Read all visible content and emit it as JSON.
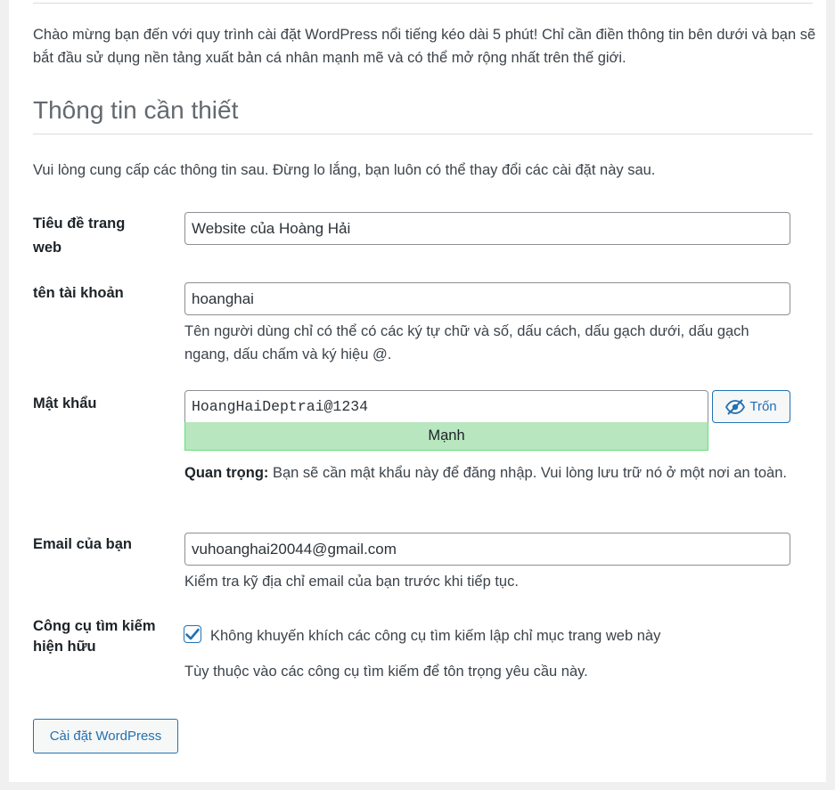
{
  "intro": "Chào mừng bạn đến với quy trình cài đặt WordPress nổi tiếng kéo dài 5 phút! Chỉ cần điền thông tin bên dưới và bạn sẽ bắt đầu sử dụng nền tảng xuất bản cá nhân mạnh mẽ và có thể mở rộng nhất trên thế giới.",
  "heading": "Thông tin cần thiết",
  "subintro": "Vui lòng cung cấp các thông tin sau. Đừng lo lắng, bạn luôn có thể thay đổi các cài đặt này sau.",
  "fields": {
    "site_title": {
      "label": "Tiêu đề trang web",
      "value": "Website của Hoàng Hải"
    },
    "username": {
      "label": "tên tài khoản",
      "value": "hoanghai",
      "description": "Tên người dùng chỉ có thể có các ký tự chữ và số, dấu cách, dấu gạch dưới, dấu gạch ngang, dấu chấm và ký hiệu @."
    },
    "password": {
      "label": "Mật khẩu",
      "value": "HoangHaiDeptrai@1234",
      "hide_button": "Trốn",
      "strength": "Mạnh",
      "important_label": "Quan trọng:",
      "important_text": " Bạn sẽ cần mật khẩu này để đăng nhập. Vui lòng lưu trữ nó ở một nơi an toàn."
    },
    "email": {
      "label": "Email của bạn",
      "value": "vuhoanghai20044@gmail.com",
      "description": "Kiểm tra kỹ địa chỉ email của bạn trước khi tiếp tục."
    },
    "search_visibility": {
      "label": "Công cụ tìm kiếm hiện hữu",
      "checkbox_label": "Không khuyến khích các công cụ tìm kiếm lập chỉ mục trang web này",
      "checked": true,
      "description": "Tùy thuộc vào các công cụ tìm kiếm để tôn trọng yêu cầu này."
    }
  },
  "submit_label": "Cài đặt WordPress",
  "colors": {
    "accent": "#2271b1",
    "strength_strong_bg": "#b8e6bf",
    "strength_strong_border": "#68de7c"
  },
  "icons": {
    "hide_button": "eye-slash-icon",
    "checkbox": "checkmark-icon"
  }
}
